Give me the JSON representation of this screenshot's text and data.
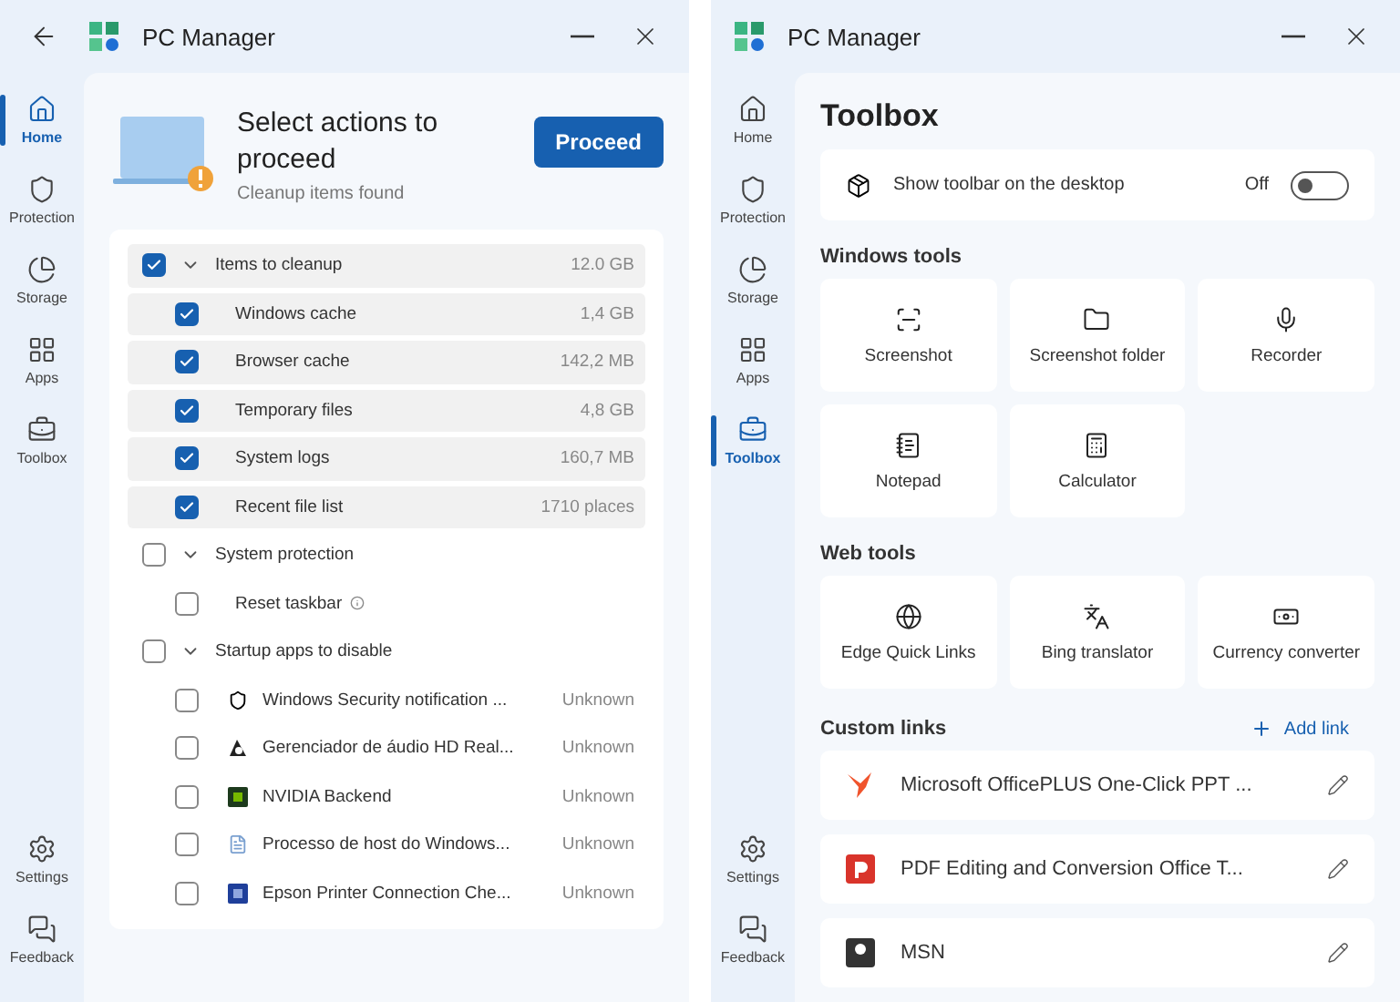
{
  "cleanup_window": {
    "title": "PC Manager",
    "sidebar": {
      "items": [
        {
          "label": "Home",
          "selected": true
        },
        {
          "label": "Protection",
          "selected": false
        },
        {
          "label": "Storage",
          "selected": false
        },
        {
          "label": "Apps",
          "selected": false
        },
        {
          "label": "Toolbox",
          "selected": false
        }
      ],
      "bottom": [
        {
          "label": "Settings"
        },
        {
          "label": "Feedback"
        }
      ]
    },
    "header": {
      "title": "Select actions to proceed",
      "subtitle": "Cleanup items found",
      "button": "Proceed"
    },
    "groups": [
      {
        "label": "Items to cleanup",
        "checked": true,
        "expanded": true,
        "value": "12.0 GB",
        "items": [
          {
            "label": "Windows cache",
            "checked": true,
            "value": "1,4 GB"
          },
          {
            "label": "Browser cache",
            "checked": true,
            "value": "142,2 MB"
          },
          {
            "label": "Temporary files",
            "checked": true,
            "value": "4,8 GB"
          },
          {
            "label": "System logs",
            "checked": true,
            "value": "160,7 MB"
          },
          {
            "label": "Recent file list",
            "checked": true,
            "value": "1710 places"
          }
        ]
      },
      {
        "label": "System protection",
        "checked": false,
        "expanded": true,
        "items": [
          {
            "label": "Reset taskbar",
            "checked": false,
            "info": true
          }
        ]
      },
      {
        "label": "Startup apps to disable",
        "checked": false,
        "expanded": true,
        "items": [
          {
            "label": "Windows Security notification ...",
            "checked": false,
            "value": "Unknown"
          },
          {
            "label": "Gerenciador de áudio HD Real...",
            "checked": false,
            "value": "Unknown"
          },
          {
            "label": "NVIDIA Backend",
            "checked": false,
            "value": "Unknown"
          },
          {
            "label": "Processo de host do Windows...",
            "checked": false,
            "value": "Unknown"
          },
          {
            "label": "Epson Printer Connection Che...",
            "checked": false,
            "value": "Unknown"
          }
        ]
      }
    ]
  },
  "toolbox_window": {
    "title": "PC Manager",
    "sidebar": {
      "items": [
        {
          "label": "Home",
          "selected": false
        },
        {
          "label": "Protection",
          "selected": false
        },
        {
          "label": "Storage",
          "selected": false
        },
        {
          "label": "Apps",
          "selected": false
        },
        {
          "label": "Toolbox",
          "selected": true
        }
      ],
      "bottom": [
        {
          "label": "Settings"
        },
        {
          "label": "Feedback"
        }
      ]
    },
    "heading": "Toolbox",
    "toolbar_setting": {
      "label": "Show toolbar on the desktop",
      "state": "Off",
      "on": false
    },
    "sections": [
      {
        "title": "Windows tools",
        "tools": [
          {
            "label": "Screenshot"
          },
          {
            "label": "Screenshot folder"
          },
          {
            "label": "Recorder"
          },
          {
            "label": "Notepad"
          },
          {
            "label": "Calculator"
          }
        ]
      },
      {
        "title": "Web tools",
        "tools": [
          {
            "label": "Edge Quick Links"
          },
          {
            "label": "Bing translator"
          },
          {
            "label": "Currency converter"
          }
        ]
      }
    ],
    "custom_links": {
      "title": "Custom links",
      "add": "Add link",
      "links": [
        {
          "label": "Microsoft OfficePLUS One-Click PPT ..."
        },
        {
          "label": "PDF Editing and Conversion Office T..."
        },
        {
          "label": "MSN"
        }
      ]
    }
  }
}
